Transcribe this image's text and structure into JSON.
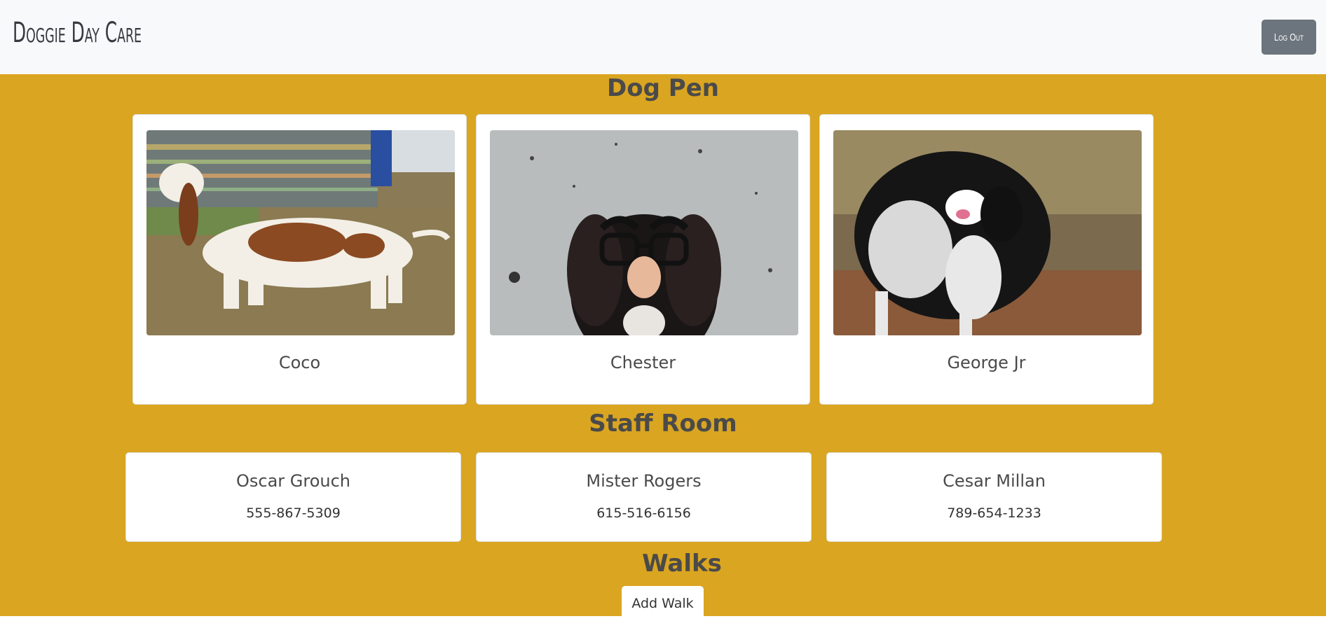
{
  "navbar": {
    "brand": "Doggie Day Care",
    "logout_label": "Log Out"
  },
  "colors": {
    "main_background": "#daa520",
    "navbar_background": "#f8f9fa",
    "logout_button": "#6c757d"
  },
  "dog_pen": {
    "title": "Dog Pen",
    "dogs": [
      {
        "name": "Coco",
        "photo": "basset-hound-photo"
      },
      {
        "name": "Chester",
        "photo": "dog-with-groucho-glasses-photo"
      },
      {
        "name": "George Jr",
        "photo": "wet-dog-shaking-photo"
      }
    ]
  },
  "staff_room": {
    "title": "Staff Room",
    "staff": [
      {
        "name": "Oscar Grouch",
        "phone": "555-867-5309"
      },
      {
        "name": "Mister Rogers",
        "phone": "615-516-6156"
      },
      {
        "name": "Cesar Millan",
        "phone": "789-654-1233"
      }
    ]
  },
  "walks": {
    "title": "Walks",
    "add_walk_label": "Add Walk"
  }
}
